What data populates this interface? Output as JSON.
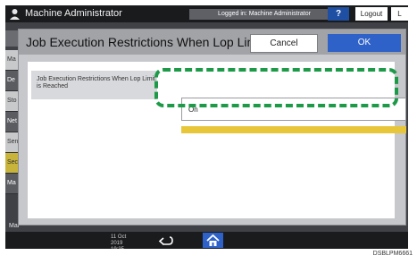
{
  "topbar": {
    "title": "Machine Administrator",
    "logged_in": "Logged in: Machine Administrator",
    "help_label": "?",
    "logout_label": "Logout",
    "lang_label": "L"
  },
  "background": {
    "rows": [
      "Ma",
      "De",
      "Sto",
      "Net",
      "Sen",
      "Sec",
      "Ma"
    ],
    "bottom_label": "Mai"
  },
  "dialog": {
    "title": "Job Execution Restrictions When Lop Limit is...",
    "cancel_label": "Cancel",
    "ok_label": "OK",
    "setting_label": "Job Execution Restrictions When Lop Limit is Reached",
    "value": "On"
  },
  "bottombar": {
    "clock": "11 Oct 2019 19:35"
  },
  "image_id": "DSBLPM6661",
  "colors": {
    "highlight": "#1d9a48",
    "ok_button": "#2e62c9",
    "accent_bar": "#e8c63a"
  }
}
